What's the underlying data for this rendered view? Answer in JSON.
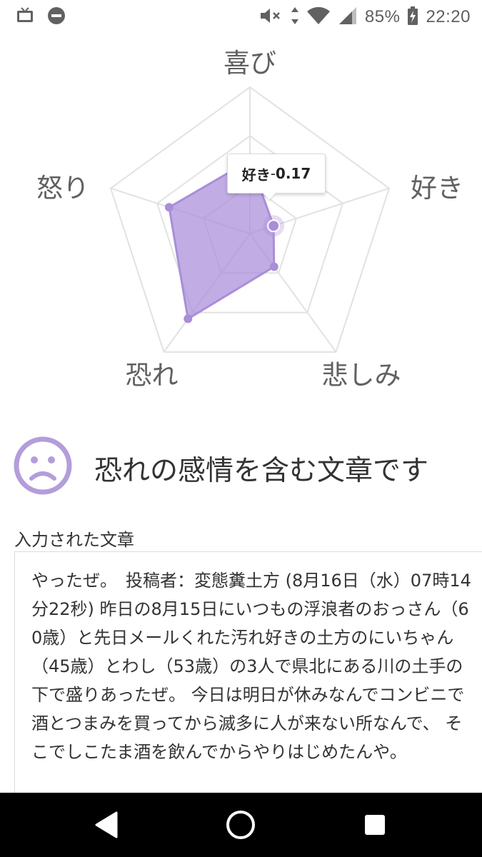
{
  "status_bar": {
    "battery_percent": "85%",
    "time": "22:20",
    "icons": [
      "tv-icon",
      "do-not-disturb-icon",
      "mute-icon",
      "data-transfer-icon",
      "wifi-icon",
      "signal-icon",
      "battery-charging-icon"
    ]
  },
  "radar": {
    "axes": [
      {
        "label": "喜び",
        "value": 0.5
      },
      {
        "label": "好き",
        "value": 0.17
      },
      {
        "label": "悲しみ",
        "value": 0.28
      },
      {
        "label": "恐れ",
        "value": 0.72
      },
      {
        "label": "怒り",
        "value": 0.58
      }
    ],
    "scale_max": 1,
    "grid_levels": 3,
    "fill_color": "#a98ed8",
    "line_color": "#a98ed8",
    "grid_color": "#e2e2e2",
    "tooltip": {
      "label": "好き",
      "separator": " - ",
      "value": "0.17"
    }
  },
  "result": {
    "icon": "sad-face-icon",
    "icon_color": "#b39ddb",
    "text": "恐れの感情を含む文章です"
  },
  "input": {
    "label": "入力された文章",
    "text": "やったぜ。　投稿者：変態糞土方 (8月16日（水）07時14分22秒) 昨日の8月15日にいつもの浮浪者のおっさん（60歳）と先日メールくれた汚れ好きの土方のにいちゃん （45歳）とわし（53歳）の3人で県北にある川の土手の下で盛りあったぜ。 今日は明日が休みなんでコンビニで酒とつまみを買ってから滅多に人が来ない所なんで、 そこでしこたま酒を飲んでからやりはじめたんや。"
  },
  "nav_bar": {
    "buttons": [
      "back-icon",
      "home-icon",
      "recents-icon"
    ]
  }
}
